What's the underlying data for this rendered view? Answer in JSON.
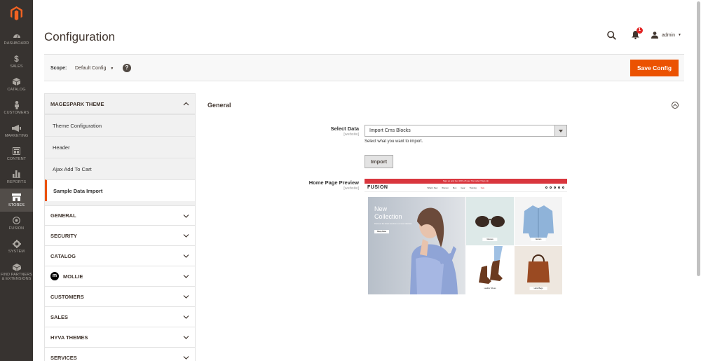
{
  "sidebar": {
    "items": [
      {
        "label": "DASHBOARD",
        "icon": "dashboard-icon"
      },
      {
        "label": "SALES",
        "icon": "dollar-icon"
      },
      {
        "label": "CATALOG",
        "icon": "cube-icon"
      },
      {
        "label": "CUSTOMERS",
        "icon": "person-icon"
      },
      {
        "label": "MARKETING",
        "icon": "megaphone-icon"
      },
      {
        "label": "CONTENT",
        "icon": "layout-icon"
      },
      {
        "label": "REPORTS",
        "icon": "bar-chart-icon"
      },
      {
        "label": "STORES",
        "icon": "store-icon"
      },
      {
        "label": "FUSION",
        "icon": "fusion-icon"
      },
      {
        "label": "SYSTEM",
        "icon": "gear-icon"
      },
      {
        "label": "FIND PARTNERS & EXTENSIONS",
        "icon": "cubes-icon"
      }
    ],
    "active": "STORES"
  },
  "header": {
    "title": "Configuration",
    "notification_count": "1",
    "user": "admin"
  },
  "scope": {
    "label": "Scope:",
    "value": "Default Config",
    "save_label": "Save Config"
  },
  "config_nav": {
    "theme_section": "MAGESPARK THEME",
    "theme_items": [
      "Theme Configuration",
      "Header",
      "Ajax Add To Cart",
      "Sample Data Import"
    ],
    "groups": [
      "GENERAL",
      "SECURITY",
      "CATALOG",
      "MOLLIE",
      "CUSTOMERS",
      "SALES",
      "HYVA THEMES",
      "SERVICES"
    ]
  },
  "main": {
    "section_title": "General",
    "select_data": {
      "label": "Select Data",
      "scope": "[website]",
      "value": "Import Cms Blocks",
      "note": "Select what you want to import.",
      "import_label": "Import"
    },
    "preview": {
      "label": "Home Page Preview",
      "scope": "[website]",
      "topbar": "Sign up and Get 10% off your first order! Sign Up",
      "brand": "FUSION",
      "menu": [
        "What's New",
        "Women",
        "Men",
        "Gear",
        "Training",
        "Sale"
      ],
      "hero_title_1": "New",
      "hero_title_2": "Collection",
      "hero_subtitle": "Discover the latest trends in our new collection",
      "hero_button": "Shop Now",
      "tiles": [
        "Glasses",
        "Jackets",
        "Leather Shoes",
        "Hand Bags"
      ]
    }
  },
  "colors": {
    "sidebar": "#373330",
    "accent": "#eb5202",
    "preview_bar": "#d9363e"
  }
}
